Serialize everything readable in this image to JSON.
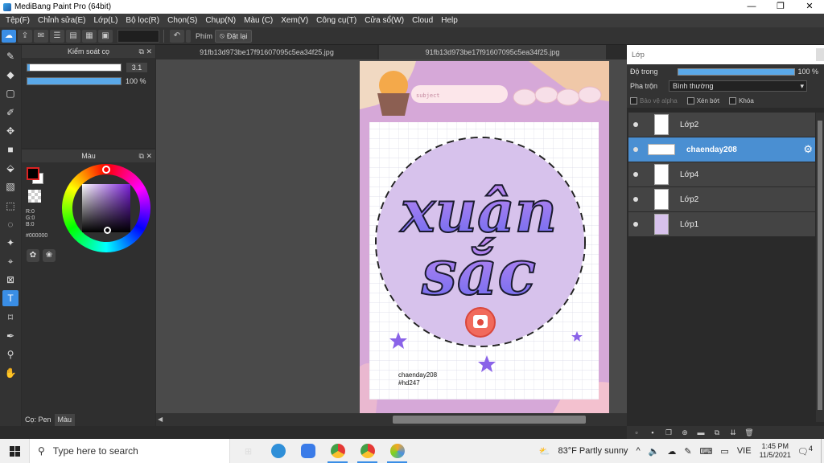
{
  "window": {
    "title": "MediBang Paint Pro (64bit)",
    "controls": [
      "—",
      "❐",
      "✕"
    ]
  },
  "menu": [
    "Tệp(F)",
    "Chỉnh sửa(E)",
    "Lớp(L)",
    "Bộ lọc(R)",
    "Chọn(S)",
    "Chụp(N)",
    "Màu (C)",
    "Xem(V)",
    "Công cụ(T)",
    "Cửa sổ(W)",
    "Cloud",
    "Help"
  ],
  "toolbar": {
    "keys_label": "Phím",
    "reset_label": "Đặt lại"
  },
  "brush_panel": {
    "title": "Kiểm soát cọ",
    "size_value": "3.1",
    "opacity_value": "100 %",
    "size_fraction": 0.03,
    "opacity_fraction": 1.0
  },
  "color_panel": {
    "title": "Màu",
    "r": "R:0",
    "g": "G:0",
    "b": "B:0",
    "hex": "#000000",
    "foreground": "#000000",
    "background": "#ffffff"
  },
  "bottom_tabs": [
    "Cọ: Pen",
    "Màu"
  ],
  "doc_tabs": [
    "91fb13d973be17f91607095c5ea34f25.jpg",
    "91fb13d973be17f91607095c5ea34f25.jpg"
  ],
  "artwork": {
    "subject_label": "subject",
    "title_line1": "xuân",
    "title_line2": "sắc",
    "credit_line1": "chaenday208",
    "credit_line2": "#hd247",
    "accent": "#8a63e8",
    "circle_color": "#d7c2ec",
    "border_color": "#d8a9d9"
  },
  "layer_panel": {
    "title": "Lớp",
    "opacity_label": "Độ trong",
    "opacity_value": "100 %",
    "blend_label": "Pha trộn",
    "blend_value": "Bình thường",
    "checks": [
      "Bảo vệ alpha",
      "Xén bớt",
      "Khóa"
    ],
    "layers": [
      {
        "name": "Lớp2",
        "selected": false
      },
      {
        "name": "chaenday208",
        "selected": true
      },
      {
        "name": "Lớp4",
        "selected": false
      },
      {
        "name": "Lớp2",
        "selected": false
      },
      {
        "name": "Lớp1",
        "selected": false
      }
    ]
  },
  "taskbar": {
    "search_placeholder": "Type here to search",
    "weather": "83°F  Partly sunny",
    "language": "VIE",
    "time": "1:45 PM",
    "date": "11/5/2021",
    "notifications": "4"
  }
}
